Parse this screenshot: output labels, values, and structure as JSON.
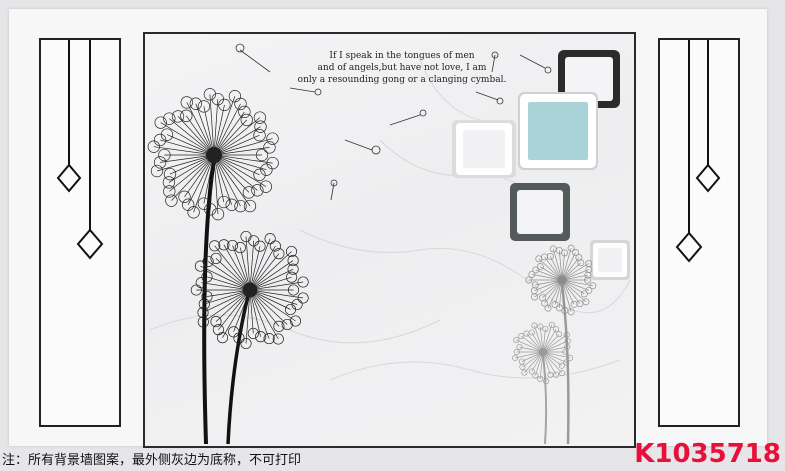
{
  "quote": {
    "line1": "If I speak in the tongues of men",
    "line2": "and of angels,but have not love, I am",
    "line3": "only a resounding gong or a clanging cymbal."
  },
  "footer": {
    "note": "注：所有背景墙图案，最外侧灰边为底称，不可打印",
    "code": "K1035718"
  },
  "colors": {
    "accent_square": "#a9d3d6",
    "code_red": "#e8103a",
    "frame_line": "#222222"
  }
}
